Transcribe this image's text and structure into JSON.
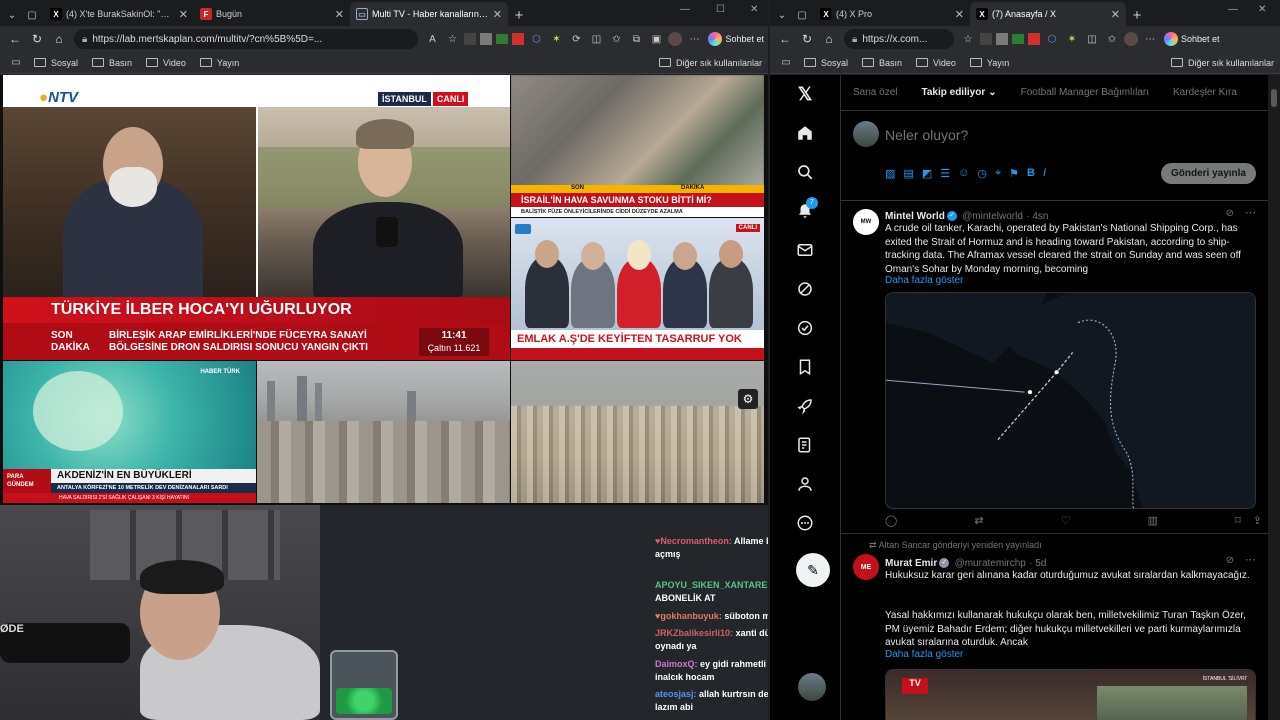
{
  "left_window": {
    "tabs": [
      {
        "title": "(4) X'te BurakSakinOl: \"Sinners alır",
        "active": false
      },
      {
        "title": "Bugün",
        "active": false
      },
      {
        "title": "Multi TV - Haber kanallarını aynı an",
        "active": true
      }
    ],
    "url": "https://lab.mertskaplan.com/multitv/?cn%5B%5D=...",
    "chat_button": "Sohbet et",
    "bookmarks": [
      "Sosyal",
      "Basın",
      "Video",
      "Yayın"
    ],
    "other_bookmarks": "Diğer sık kullanılanlar"
  },
  "multitv": {
    "ntv": {
      "logo": "NTV",
      "location": "İSTANBUL",
      "live": "CANLI",
      "headline": "TÜRKİYE İLBER HOCA'YI UĞURLUYOR",
      "son": "SON",
      "dakika": "DAKİKA",
      "news_line1": "BİRLEŞİK ARAP EMİRLİKLERİ'NDE FÜCEYRA SANAYİ",
      "news_line2": "BÖLGESİNE DRON SALDIRISI SONUCU YANGIN ÇIKTI",
      "time": "11:41",
      "index": "Çaltın 11.621"
    },
    "tr_breaking": {
      "son": "SON",
      "dakika": "DAKİKA",
      "headline": "İSRAİL'İN HAVA SAVUNMA STOKU BİTTİ Mİ?",
      "subline": "BALİSTİK FÜZE ÖNLEYİCİLERİNDE CİDDİ DÜZEYDE AZALMA"
    },
    "sozcu": {
      "live": "CANLI",
      "headline": "EMLAK A.Ş'DE KEYİFTEN TASARRUF YOK"
    },
    "haberturk": {
      "brand": "HABER TÜRK",
      "para": "PARA",
      "gundem": "GÜNDEM",
      "headline": "AKDENİZ'İN EN BÜYÜKLERİ",
      "subline": "ANTALYA KÖRFEZİ'NE 10 METRELİK DEV DENİZANALARI SARDI",
      "ticker": "HAVA SALDIRISI 2'Sİ SAĞLIK ÇALIŞANI 3 KİŞİ HAYATINI"
    },
    "settings_icon": "gear-icon"
  },
  "chat": [
    {
      "user": "Necromantheon:",
      "msg": "Allame bile gym açmış",
      "color": "#e05a6a"
    },
    {
      "user": "APOYU_SIKEN_XANTARES:",
      "msg": "ABONELİK AT",
      "color": "#58c48a"
    },
    {
      "user": "gokhanbuyuk:",
      "msg": "süboton mu",
      "color": "#e07a5a"
    },
    {
      "user": "JRKZbalikesirli10:",
      "msg": "xanti dün kötü oynadı ya",
      "color": "#d06060"
    },
    {
      "user": "DaimoxQ:",
      "msg": "ey gidi rahmetli halil inalcık hocam",
      "color": "#cc77cc"
    },
    {
      "user": "ateosjasj:",
      "msg": "allah kurtrsın demen lazım abi",
      "color": "#5b8ff0"
    }
  ],
  "right_window": {
    "tabs": [
      {
        "title": "(4) X Pro",
        "active": false
      },
      {
        "title": "(7) Anasayfa / X",
        "active": true
      }
    ],
    "url": "https://x.com...",
    "chat_button": "Sohbet et",
    "bookmarks": [
      "Sosyal",
      "Basın",
      "Video",
      "Yayın"
    ],
    "other_bookmarks": "Diğer sık kullanılanlar"
  },
  "x": {
    "tabs": [
      "Sana özel",
      "Takip ediliyor",
      "Football Manager Bağımlıları",
      "Kardeşler Kıra"
    ],
    "notifications_badge": "7",
    "composer_placeholder": "Neler oluyor?",
    "post_button": "Gönderi yayınla",
    "posts": [
      {
        "name": "Mintel World",
        "handle": "@mintelworld",
        "time": "· 4sn",
        "text": "A crude oil tanker, Karachi, operated by Pakistan's National Shipping Corp., has exited the Strait of Hormuz and is heading toward Pakistan, according to ship-tracking data. The Aframax vessel cleared the strait on Sunday and was seen off Oman's Sohar by Monday morning, becoming",
        "more": "Daha fazla göster"
      },
      {
        "repost_note": "Altan Sancar gönderiyi yeniden yayınladı",
        "name": "Murat Emir",
        "handle": "@muratemirchp",
        "time": "· 5d",
        "text1": "Hukuksuz karar geri alınana kadar oturduğumuz avukat sıralardan kalkmayacağız.",
        "text2": "Yasal hakkımızı kullanarak hukukçu olarak ben, milletvekilimiz Turan Taşkın Özer, PM üyemiz Bahadır Erdem; diğer hukukçu milletvekilleri ve parti kurmaylarımızla avukat sıralarına oturduk. Ancak",
        "more": "Daha fazla göster",
        "image_caption": "İSTANBUL 'SİLİVRİ'"
      }
    ]
  }
}
